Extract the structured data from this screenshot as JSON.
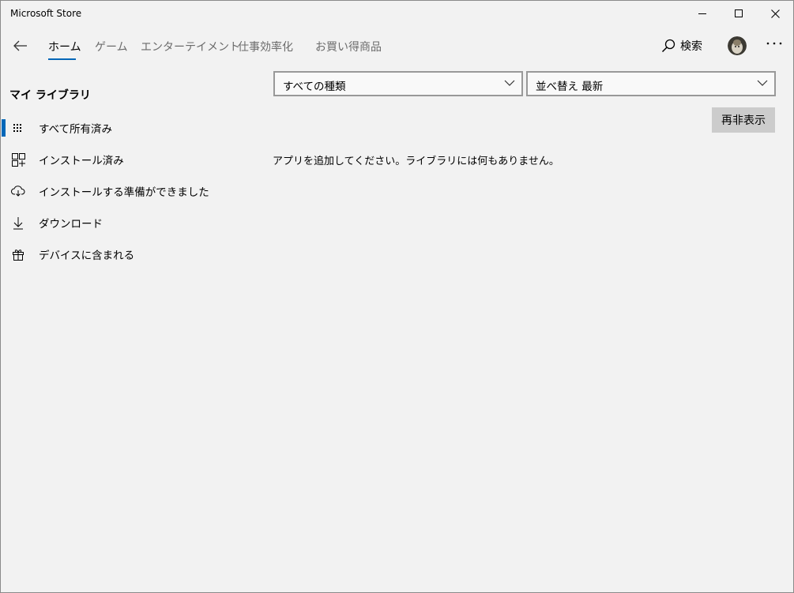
{
  "window": {
    "title": "Microsoft Store"
  },
  "nav": {
    "tabs": [
      {
        "label": "ホーム",
        "active": true
      },
      {
        "label": "ゲーム",
        "active": false
      },
      {
        "label": "エンターテイメント",
        "active": false
      },
      {
        "label": "仕事効率化",
        "active": false
      },
      {
        "label": "お買い得商品",
        "active": false
      }
    ],
    "search_label": "検索",
    "accent_color": "#0067b8"
  },
  "sidebar": {
    "title": "マイ ライブラリ",
    "items": [
      {
        "label": "すべて所有済み",
        "icon": "grid-dots-icon",
        "selected": true
      },
      {
        "label": "インストール済み",
        "icon": "apps-grid-icon",
        "selected": false
      },
      {
        "label": "インストールする準備ができました",
        "icon": "cloud-download-icon",
        "selected": false
      },
      {
        "label": "ダウンロード",
        "icon": "download-icon",
        "selected": false
      },
      {
        "label": "デバイスに含まれる",
        "icon": "gift-icon",
        "selected": false
      }
    ]
  },
  "content": {
    "type_select": {
      "value": "すべての種類"
    },
    "sort_select": {
      "value": "並べ替え 最新"
    },
    "refresh_label": "再非表示",
    "empty_message": "アプリを追加してください。ライブラリには何もありません。"
  }
}
